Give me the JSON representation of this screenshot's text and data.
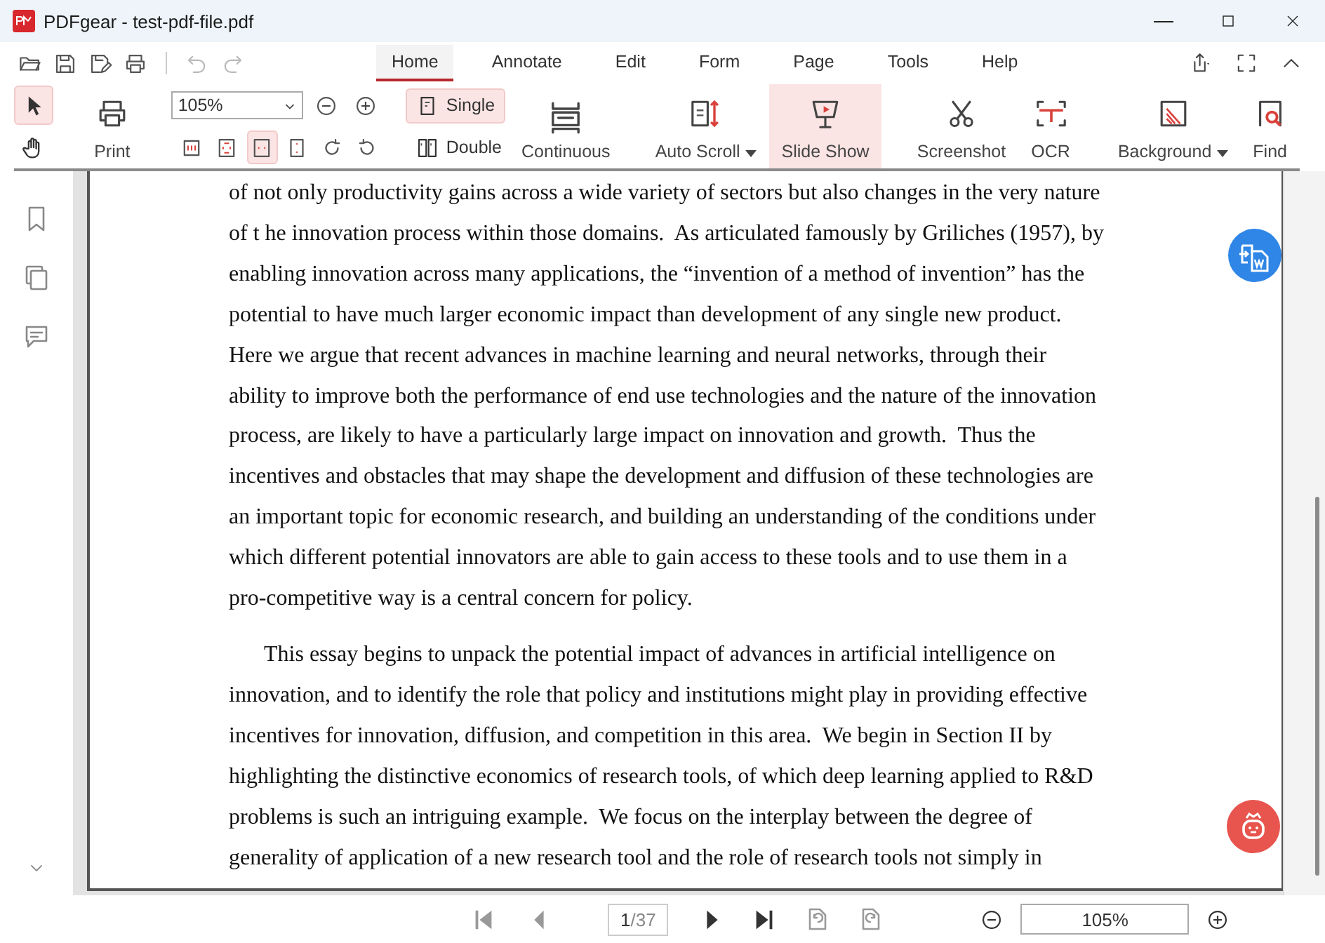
{
  "window": {
    "title": "PDFgear - test-pdf-file.pdf"
  },
  "quick_access": [
    {
      "kind": "open",
      "disabled": false
    },
    {
      "kind": "save",
      "disabled": false
    },
    {
      "kind": "save-as",
      "disabled": false
    },
    {
      "kind": "print",
      "disabled": false
    },
    {
      "kind": "undo",
      "disabled": true
    },
    {
      "kind": "redo",
      "disabled": true
    }
  ],
  "menu_tabs": [
    {
      "label": "Home",
      "selected": true
    },
    {
      "label": "Annotate",
      "selected": false
    },
    {
      "label": "Edit",
      "selected": false
    },
    {
      "label": "Form",
      "selected": false
    },
    {
      "label": "Page",
      "selected": false
    },
    {
      "label": "Tools",
      "selected": false
    },
    {
      "label": "Help",
      "selected": false
    }
  ],
  "ribbon": {
    "tools": [
      {
        "kind": "select",
        "selected": true
      },
      {
        "kind": "hand",
        "selected": false
      }
    ],
    "print": {
      "label": "Print"
    },
    "zoom": {
      "value": "105%"
    },
    "fit_buttons": [
      {
        "kind": "actual-size",
        "selected": false
      },
      {
        "kind": "fit-page",
        "selected": false
      },
      {
        "kind": "fit-width",
        "selected": true
      },
      {
        "kind": "fit-height",
        "selected": false
      },
      {
        "kind": "rotate-cw",
        "selected": false
      },
      {
        "kind": "rotate-ccw",
        "selected": false
      }
    ],
    "layout": [
      {
        "kind": "single",
        "label": "Single",
        "selected": true
      },
      {
        "kind": "double",
        "label": "Double",
        "selected": false
      },
      {
        "kind": "continuous",
        "label": "Continuous",
        "selected": false
      }
    ],
    "action_groups": [
      [
        {
          "kind": "auto-scroll",
          "label": "Auto Scroll",
          "dropdown": true,
          "selected": false
        },
        {
          "kind": "slide-show",
          "label": "Slide Show",
          "dropdown": false,
          "selected": true
        }
      ],
      [
        {
          "kind": "screenshot",
          "label": "Screenshot",
          "dropdown": false,
          "selected": false
        },
        {
          "kind": "ocr",
          "label": "OCR",
          "dropdown": false,
          "selected": false
        }
      ],
      [
        {
          "kind": "background",
          "label": "Background",
          "dropdown": true,
          "selected": false
        },
        {
          "kind": "find",
          "label": "Find",
          "dropdown": false,
          "selected": false
        }
      ]
    ]
  },
  "document": {
    "paragraphs": [
      {
        "indent": false,
        "lines": [
          "of not only productivity gains across a wide variety of sectors but also changes in the very nature",
          "of t he innovation process within those domains.  As articulated famously by Griliches (1957), by",
          "enabling innovation across many applications, the “invention of a method of invention” has the",
          "potential to have much larger economic impact than development of any single new product.",
          "Here we argue that recent advances in machine learning and neural networks, through their",
          "ability to improve both the performance of end use technologies and the nature of the innovation",
          "process, are likely to have a particularly large impact on innovation and growth.  Thus the",
          "incentives and obstacles that may shape the development and diffusion of these technologies are",
          "an important topic for economic research, and building an understanding of the conditions under",
          "which different potential innovators are able to gain access to these tools and to use them in a",
          "pro-competitive way is a central concern for policy."
        ]
      },
      {
        "indent": true,
        "lines": [
          "This essay begins to unpack the potential impact of advances in artificial intelligence on",
          "innovation, and to identify the role that policy and institutions might play in providing effective",
          "incentives for innovation, diffusion, and competition in this area.  We begin in Section II by",
          "highlighting the distinctive economics of research tools, of which deep learning applied to R&D",
          "problems is such an intriguing example.  We focus on the interplay between the degree of",
          "generality of application of a new research tool and the role of research tools not simply in"
        ]
      }
    ]
  },
  "status_bar": {
    "nav": [
      {
        "kind": "first",
        "disabled": true
      },
      {
        "kind": "prev",
        "disabled": true
      }
    ],
    "page": {
      "value": "1",
      "total": "/37"
    },
    "nav_after": [
      {
        "kind": "next",
        "disabled": false
      },
      {
        "kind": "last",
        "disabled": false
      },
      {
        "kind": "rotate-left-page",
        "disabled": true
      },
      {
        "kind": "rotate-right-page",
        "disabled": true
      }
    ],
    "zoom": {
      "value": "105%"
    }
  }
}
